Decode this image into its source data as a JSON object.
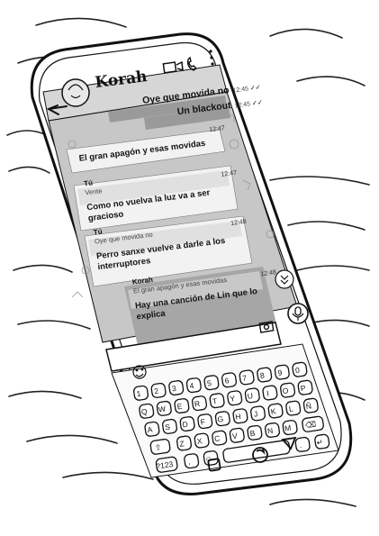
{
  "header": {
    "contact_name": "Korah"
  },
  "messages": {
    "out1": {
      "text": "Oye que movida no",
      "time": "12:45",
      "ticks": "✓✓"
    },
    "out2": {
      "text": "Un blackout",
      "time": "12:45",
      "ticks": "✓✓"
    },
    "in1": {
      "text": "El gran apagón y esas movidas",
      "time": "12:47"
    },
    "in2": {
      "quote_author": "Tú",
      "quote_text": "Vente",
      "text": "Como no vuelva la luz va a ser gracioso",
      "time": "12:47"
    },
    "in3": {
      "quote_author": "Tú",
      "quote_text": "Oye que movida no",
      "text": "Perro sanxe vuelve a darle a los interruptores",
      "time": "12:48"
    },
    "sel": {
      "quote_author": "Korah",
      "quote_text": "El gran apagón y esas movidas",
      "text": "Hay una canción de Lin que lo explica",
      "time": "12:48"
    }
  },
  "keyboard": {
    "row1": [
      "1",
      "2",
      "3",
      "4",
      "5",
      "6",
      "7",
      "8",
      "9",
      "0"
    ],
    "row2": [
      "Q",
      "W",
      "E",
      "R",
      "T",
      "Y",
      "U",
      "I",
      "O",
      "P"
    ],
    "row3": [
      "A",
      "S",
      "D",
      "F",
      "G",
      "H",
      "J",
      "K",
      "L",
      "Ñ"
    ],
    "row4": [
      "Z",
      "X",
      "C",
      "V",
      "B",
      "N",
      "M"
    ],
    "sym_label": "?123",
    "comma": ",",
    "period": "."
  }
}
